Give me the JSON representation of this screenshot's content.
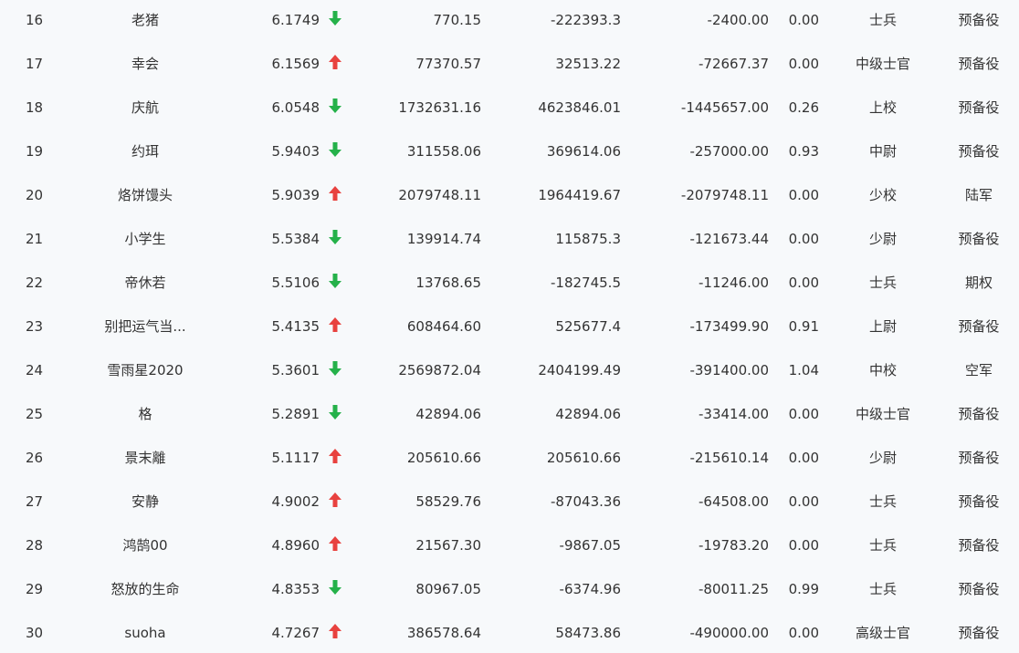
{
  "colors": {
    "background": "#f7f9fb",
    "text": "#333333",
    "up": "#e8423f",
    "down": "#25b14a"
  },
  "rows": [
    {
      "rank": "16",
      "name": "老猪",
      "score": "6.1749",
      "trend": "down",
      "v1": "770.15",
      "v2": "-222393.3",
      "v3": "-2400.00",
      "v4": "0.00",
      "rank_title": "士兵",
      "status": "预备役"
    },
    {
      "rank": "17",
      "name": "幸会",
      "score": "6.1569",
      "trend": "up",
      "v1": "77370.57",
      "v2": "32513.22",
      "v3": "-72667.37",
      "v4": "0.00",
      "rank_title": "中级士官",
      "status": "预备役"
    },
    {
      "rank": "18",
      "name": "庆航",
      "score": "6.0548",
      "trend": "down",
      "v1": "1732631.16",
      "v2": "4623846.01",
      "v3": "-1445657.00",
      "v4": "0.26",
      "rank_title": "上校",
      "status": "预备役"
    },
    {
      "rank": "19",
      "name": "约珥",
      "score": "5.9403",
      "trend": "down",
      "v1": "311558.06",
      "v2": "369614.06",
      "v3": "-257000.00",
      "v4": "0.93",
      "rank_title": "中尉",
      "status": "预备役"
    },
    {
      "rank": "20",
      "name": "烙饼馒头",
      "score": "5.9039",
      "trend": "up",
      "v1": "2079748.11",
      "v2": "1964419.67",
      "v3": "-2079748.11",
      "v4": "0.00",
      "rank_title": "少校",
      "status": "陆军"
    },
    {
      "rank": "21",
      "name": "小学生",
      "score": "5.5384",
      "trend": "down",
      "v1": "139914.74",
      "v2": "115875.3",
      "v3": "-121673.44",
      "v4": "0.00",
      "rank_title": "少尉",
      "status": "预备役"
    },
    {
      "rank": "22",
      "name": "帝休若",
      "score": "5.5106",
      "trend": "down",
      "v1": "13768.65",
      "v2": "-182745.5",
      "v3": "-11246.00",
      "v4": "0.00",
      "rank_title": "士兵",
      "status": "期权"
    },
    {
      "rank": "23",
      "name": "别把运气当...",
      "score": "5.4135",
      "trend": "up",
      "v1": "608464.60",
      "v2": "525677.4",
      "v3": "-173499.90",
      "v4": "0.91",
      "rank_title": "上尉",
      "status": "预备役"
    },
    {
      "rank": "24",
      "name": "雪雨星2020",
      "score": "5.3601",
      "trend": "down",
      "v1": "2569872.04",
      "v2": "2404199.49",
      "v3": "-391400.00",
      "v4": "1.04",
      "rank_title": "中校",
      "status": "空军"
    },
    {
      "rank": "25",
      "name": "格",
      "score": "5.2891",
      "trend": "down",
      "v1": "42894.06",
      "v2": "42894.06",
      "v3": "-33414.00",
      "v4": "0.00",
      "rank_title": "中级士官",
      "status": "预备役"
    },
    {
      "rank": "26",
      "name": "景末離",
      "score": "5.1117",
      "trend": "up",
      "v1": "205610.66",
      "v2": "205610.66",
      "v3": "-215610.14",
      "v4": "0.00",
      "rank_title": "少尉",
      "status": "预备役"
    },
    {
      "rank": "27",
      "name": "安静",
      "score": "4.9002",
      "trend": "up",
      "v1": "58529.76",
      "v2": "-87043.36",
      "v3": "-64508.00",
      "v4": "0.00",
      "rank_title": "士兵",
      "status": "预备役"
    },
    {
      "rank": "28",
      "name": "鸿鹄00",
      "score": "4.8960",
      "trend": "up",
      "v1": "21567.30",
      "v2": "-9867.05",
      "v3": "-19783.20",
      "v4": "0.00",
      "rank_title": "士兵",
      "status": "预备役"
    },
    {
      "rank": "29",
      "name": "怒放的生命",
      "score": "4.8353",
      "trend": "down",
      "v1": "80967.05",
      "v2": "-6374.96",
      "v3": "-80011.25",
      "v4": "0.99",
      "rank_title": "士兵",
      "status": "预备役"
    },
    {
      "rank": "30",
      "name": "suoha",
      "score": "4.7267",
      "trend": "up",
      "v1": "386578.64",
      "v2": "58473.86",
      "v3": "-490000.00",
      "v4": "0.00",
      "rank_title": "高级士官",
      "status": "预备役"
    }
  ]
}
